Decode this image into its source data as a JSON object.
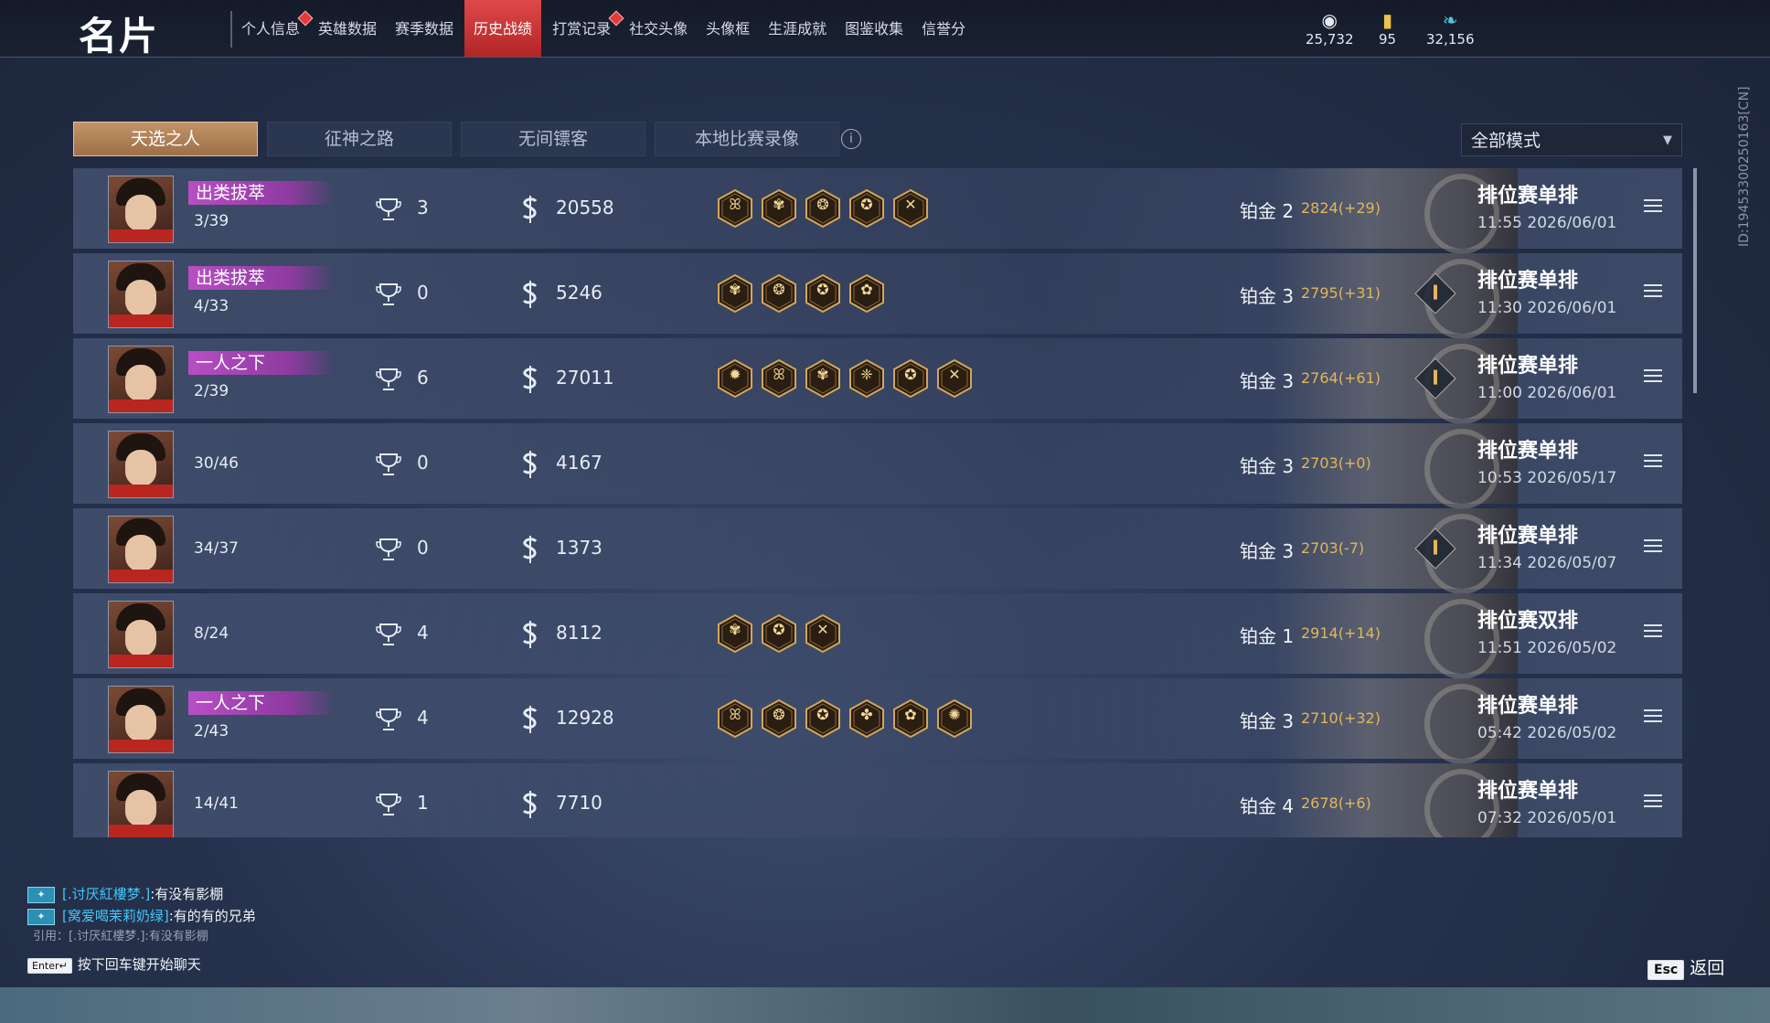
{
  "header": {
    "title": "名片",
    "nav": [
      {
        "label": "个人信息",
        "active": false,
        "dot": true
      },
      {
        "label": "英雄数据",
        "active": false,
        "dot": false
      },
      {
        "label": "赛季数据",
        "active": false,
        "dot": false
      },
      {
        "label": "历史战绩",
        "active": true,
        "dot": false
      },
      {
        "label": "打赏记录",
        "active": false,
        "dot": true
      },
      {
        "label": "社交头像",
        "active": false,
        "dot": false
      },
      {
        "label": "头像框",
        "active": false,
        "dot": false
      },
      {
        "label": "生涯成就",
        "active": false,
        "dot": false
      },
      {
        "label": "图鉴收集",
        "active": false,
        "dot": false
      },
      {
        "label": "信誉分",
        "active": false,
        "dot": false
      }
    ],
    "currencies": [
      {
        "icon": "silver-coin-icon",
        "value": "25,732"
      },
      {
        "icon": "gold-ticket-icon",
        "value": "95"
      },
      {
        "icon": "feather-icon",
        "value": "32,156"
      }
    ]
  },
  "tabs": [
    {
      "label": "天选之人",
      "active": true
    },
    {
      "label": "征神之路",
      "active": false
    },
    {
      "label": "无间镖客",
      "active": false
    },
    {
      "label": "本地比赛录像",
      "active": false
    }
  ],
  "mode_filter": {
    "value": "全部模式"
  },
  "side_id": "ID:1945330025016​3[CN]",
  "matches": [
    {
      "badge": "出类拔萃",
      "rank": "3/39",
      "kills": "3",
      "score": "20558",
      "achievements": [
        "ꕤ",
        "✾",
        "❂",
        "✪",
        "✕"
      ],
      "tier": "铂金 2",
      "points": "2824(+29)",
      "signal": false,
      "type": "排位赛单排",
      "time": "11:55  2026/06/01"
    },
    {
      "badge": "出类拔萃",
      "rank": "4/33",
      "kills": "0",
      "score": "5246",
      "achievements": [
        "✾",
        "❂",
        "✪",
        "✿"
      ],
      "tier": "铂金 3",
      "points": "2795(+31)",
      "signal": true,
      "type": "排位赛单排",
      "time": "11:30  2026/06/01"
    },
    {
      "badge": "一人之下",
      "rank": "2/39",
      "kills": "6",
      "score": "27011",
      "achievements": [
        "✹",
        "ꕤ",
        "✾",
        "❈",
        "✪",
        "✕"
      ],
      "tier": "铂金 3",
      "points": "2764(+61)",
      "signal": true,
      "type": "排位赛单排",
      "time": "11:00  2026/06/01"
    },
    {
      "badge": "",
      "rank": "30/46",
      "kills": "0",
      "score": "4167",
      "achievements": [],
      "tier": "铂金 3",
      "points": "2703(+0)",
      "signal": false,
      "type": "排位赛单排",
      "time": "10:53  2026/05/17"
    },
    {
      "badge": "",
      "rank": "34/37",
      "kills": "0",
      "score": "1373",
      "achievements": [],
      "tier": "铂金 3",
      "points": "2703(-7)",
      "signal": true,
      "type": "排位赛单排",
      "time": "11:34  2026/05/07"
    },
    {
      "badge": "",
      "rank": "8/24",
      "kills": "4",
      "score": "8112",
      "achievements": [
        "✾",
        "✪",
        "✕"
      ],
      "tier": "铂金 1",
      "points": "2914(+14)",
      "signal": false,
      "type": "排位赛双排",
      "time": "11:51  2026/05/02"
    },
    {
      "badge": "一人之下",
      "rank": "2/43",
      "kills": "4",
      "score": "12928",
      "achievements": [
        "ꕤ",
        "❂",
        "✪",
        "✤",
        "✿",
        "✺"
      ],
      "tier": "铂金 3",
      "points": "2710(+32)",
      "signal": false,
      "type": "排位赛单排",
      "time": "05:42  2026/05/02"
    },
    {
      "badge": "",
      "rank": "14/41",
      "kills": "1",
      "score": "7710",
      "achievements": [],
      "tier": "铂金 4",
      "points": "2678(+6)",
      "signal": false,
      "type": "排位赛单排",
      "time": "07:32  2026/05/01"
    }
  ],
  "chat": {
    "lines": [
      {
        "name": "[.讨厌紅樓梦.]",
        "msg": ":有没有影棚"
      },
      {
        "name": "[窝爱喝茉莉奶绿]",
        "msg": ":有的有的兄弟"
      }
    ],
    "quote": "引用：[.讨厌紅樓梦.]:有没有影棚",
    "enter_key": "Enter↵",
    "enter_hint": "按下回车键开始聊天"
  },
  "footer": {
    "esc_key": "Esc",
    "back_label": "返回"
  }
}
